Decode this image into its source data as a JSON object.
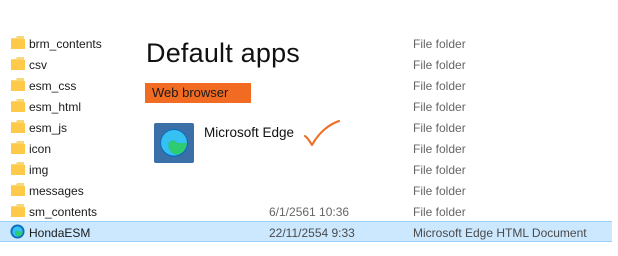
{
  "files": [
    {
      "name": "brm_contents",
      "date": "",
      "type": "File folder",
      "icon": "folder-icon"
    },
    {
      "name": "csv",
      "date": "",
      "type": "File folder",
      "icon": "folder-icon"
    },
    {
      "name": "esm_css",
      "date": "",
      "type": "File folder",
      "icon": "folder-icon"
    },
    {
      "name": "esm_html",
      "date": "",
      "type": "File folder",
      "icon": "folder-icon"
    },
    {
      "name": "esm_js",
      "date": "",
      "type": "File folder",
      "icon": "folder-icon"
    },
    {
      "name": "icon",
      "date": "",
      "type": "File folder",
      "icon": "folder-icon"
    },
    {
      "name": "img",
      "date": "",
      "type": "File folder",
      "icon": "folder-icon"
    },
    {
      "name": "messages",
      "date": "",
      "type": "File folder",
      "icon": "folder-icon"
    },
    {
      "name": "sm_contents",
      "date": "6/1/2561 10:36",
      "type": "File folder",
      "icon": "folder-icon"
    },
    {
      "name": "HondaESM",
      "date": "22/11/2554 9:33",
      "type": "Microsoft Edge HTML Document",
      "icon": "edge-icon"
    }
  ],
  "selected_file": "HondaESM",
  "default_apps": {
    "title": "Default apps",
    "section_label": "Web browser",
    "app_name": "Microsoft Edge",
    "app_icon": "edge-icon",
    "annotation": "checkmark-icon"
  },
  "colors": {
    "section_tag": "#f26b22",
    "checkmark": "#f26b22",
    "selection": "#cce8ff",
    "folder": "#f8d775"
  }
}
